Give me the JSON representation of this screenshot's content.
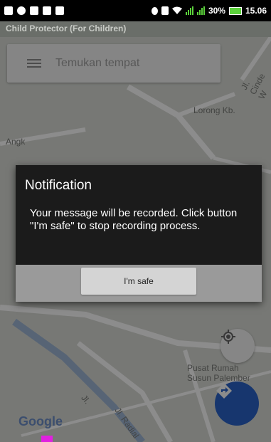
{
  "status_bar": {
    "battery": "30%",
    "time": "15.06",
    "icons": [
      "back-icon",
      "chat-icon",
      "message-icon",
      "mail-icon",
      "sim-icon",
      "location-icon",
      "vibrate-icon",
      "wifi-icon",
      "signal-icon",
      "signal-icon",
      "battery-icon"
    ]
  },
  "app": {
    "title": "Child Protector (For Children)"
  },
  "map": {
    "search_placeholder": "Temukan tempat",
    "labels": {
      "lorong": "Lorong Kb.",
      "street_top": "Jl. Cinde W",
      "angkatan": "Angk",
      "pusat1": "Pusat Rumah",
      "pusat2": "Susun Palember",
      "radial": "Jl. Radial",
      "street_bottom": "Jl."
    },
    "google_logo": "Google",
    "colors": {
      "direction_button": "#2a63c8"
    }
  },
  "dialog": {
    "title": "Notification",
    "message": "Your message will be recorded. Click button \"I'm safe\" to stop recording process.",
    "button_label": "I'm safe"
  }
}
